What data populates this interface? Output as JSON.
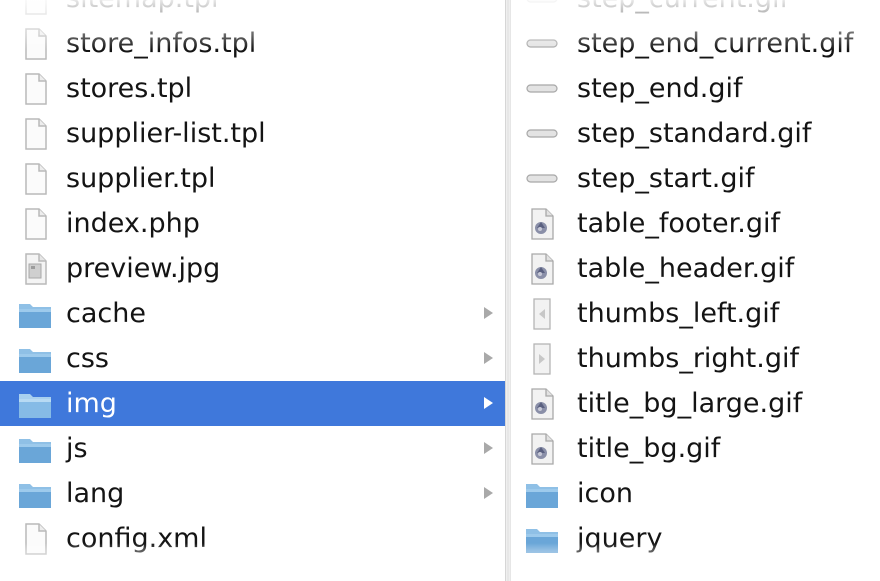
{
  "left_column": {
    "items": [
      {
        "label": "sitemap.tpl",
        "icon": "document-icon"
      },
      {
        "label": "store_infos.tpl",
        "icon": "document-icon"
      },
      {
        "label": "stores.tpl",
        "icon": "document-icon"
      },
      {
        "label": "supplier-list.tpl",
        "icon": "document-icon"
      },
      {
        "label": "supplier.tpl",
        "icon": "document-icon"
      },
      {
        "label": "index.php",
        "icon": "document-icon"
      },
      {
        "label": "preview.jpg",
        "icon": "image-file-icon"
      },
      {
        "label": "cache",
        "icon": "folder-icon"
      },
      {
        "label": "css",
        "icon": "folder-icon"
      },
      {
        "label": "img",
        "icon": "folder-icon",
        "selected": true
      },
      {
        "label": "js",
        "icon": "folder-icon"
      },
      {
        "label": "lang",
        "icon": "folder-icon"
      },
      {
        "label": "config.xml",
        "icon": "document-icon"
      }
    ]
  },
  "right_column": {
    "items": [
      {
        "label": "step_current.gif",
        "icon": "bar-thumbnail-icon"
      },
      {
        "label": "step_end_current.gif",
        "icon": "bar-thumbnail-icon"
      },
      {
        "label": "step_end.gif",
        "icon": "bar-thumbnail-icon"
      },
      {
        "label": "step_standard.gif",
        "icon": "bar-thumbnail-icon"
      },
      {
        "label": "step_start.gif",
        "icon": "bar-thumbnail-icon"
      },
      {
        "label": "table_footer.gif",
        "icon": "gif-file-icon"
      },
      {
        "label": "table_header.gif",
        "icon": "gif-file-icon"
      },
      {
        "label": "thumbs_left.gif",
        "icon": "arrow-thumbnail-icon"
      },
      {
        "label": "thumbs_right.gif",
        "icon": "arrow-thumbnail-icon"
      },
      {
        "label": "title_bg_large.gif",
        "icon": "gif-file-icon"
      },
      {
        "label": "title_bg.gif",
        "icon": "gif-file-icon"
      },
      {
        "label": "icon",
        "icon": "folder-icon"
      },
      {
        "label": "jquery",
        "icon": "folder-icon"
      }
    ]
  },
  "colors": {
    "selection": "#3f78db",
    "text": "#141414",
    "folder": "#6aa6d8",
    "arrow": "#a9a9a9"
  }
}
